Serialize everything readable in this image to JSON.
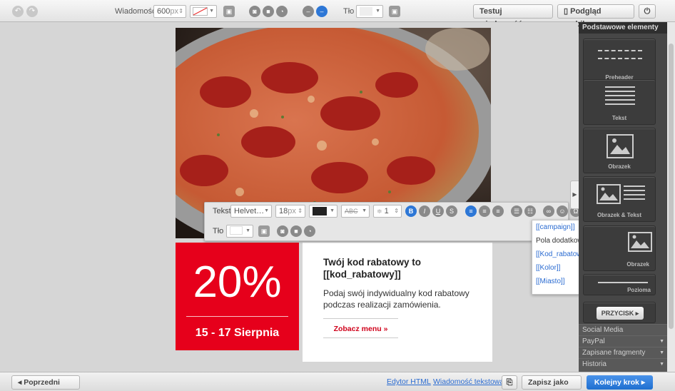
{
  "toolbar": {
    "message_label": "Wiadomość",
    "width_value": "600",
    "width_unit": "px",
    "bg_label": "Tło",
    "test_button": "Testuj wiadomość",
    "mobile_button": "Podgląd mobilny"
  },
  "email": {
    "discount": "20%",
    "dates": "15 - 17 Sierpnia",
    "headline_line1": "Twój kod rabatowy to",
    "headline_line2": "[[kod_rabatowy]]",
    "body_line1": "Podaj swój indywidualny kod rabatowy",
    "body_line2": "podczas realizacji zamówienia.",
    "cta": "Zobacz menu »"
  },
  "text_toolbar": {
    "text_label": "Tekst",
    "font_value": "Helvet…",
    "size_value": "18",
    "size_unit": "px",
    "line_height": "1",
    "bg_label": "Tło"
  },
  "fields_dropdown": {
    "items": [
      {
        "label": "[[campaign]]"
      },
      {
        "label": "Pola dodatkowe"
      },
      {
        "label": "[[Kod_rabatowy]]"
      },
      {
        "label": "[[Kolor]]"
      },
      {
        "label": "[[Miasto]]"
      }
    ]
  },
  "sidebar": {
    "header": "Podstawowe elementy",
    "tiles": {
      "preheader": "Preheader",
      "text": "Tekst",
      "image": "Obrazek",
      "image_text": "Obrazek & Tekst",
      "image2": "Obrazek",
      "divider": "Pozioma",
      "button": "PRZYCISK"
    },
    "sections": [
      "Social Media",
      "PayPal",
      "Zapisane fragmenty",
      "Historia"
    ]
  },
  "bottom": {
    "prev_step": "Poprzedni krok",
    "html_editor": "Edytor HTML",
    "text_message": "Wiadomość tekstowa",
    "save_as": "Zapisz jako",
    "next_step": "Kolejny krok"
  },
  "colors": {
    "accent": "#2d77d6",
    "promo_red": "#e6001b",
    "cta_red": "#d0021b"
  }
}
